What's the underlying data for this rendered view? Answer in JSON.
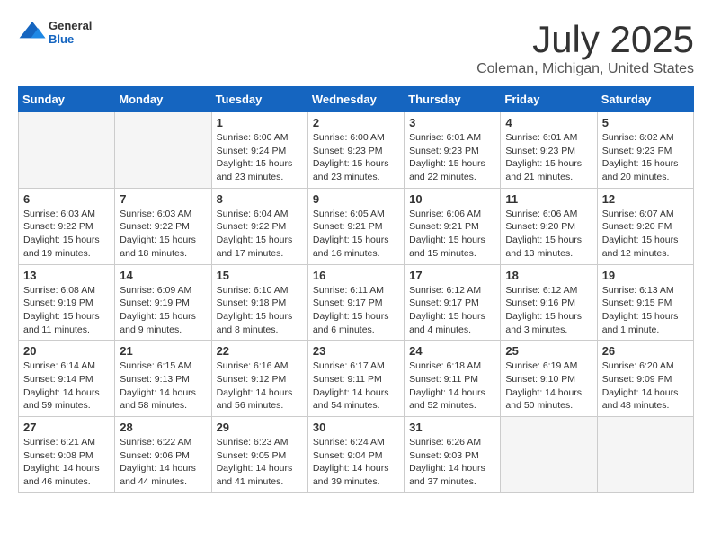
{
  "header": {
    "logo_general": "General",
    "logo_blue": "Blue",
    "month_title": "July 2025",
    "location": "Coleman, Michigan, United States"
  },
  "weekdays": [
    "Sunday",
    "Monday",
    "Tuesday",
    "Wednesday",
    "Thursday",
    "Friday",
    "Saturday"
  ],
  "weeks": [
    [
      {
        "day": "",
        "empty": true
      },
      {
        "day": "",
        "empty": true
      },
      {
        "day": "1",
        "sunrise": "6:00 AM",
        "sunset": "9:24 PM",
        "daylight": "15 hours and 23 minutes."
      },
      {
        "day": "2",
        "sunrise": "6:00 AM",
        "sunset": "9:23 PM",
        "daylight": "15 hours and 23 minutes."
      },
      {
        "day": "3",
        "sunrise": "6:01 AM",
        "sunset": "9:23 PM",
        "daylight": "15 hours and 22 minutes."
      },
      {
        "day": "4",
        "sunrise": "6:01 AM",
        "sunset": "9:23 PM",
        "daylight": "15 hours and 21 minutes."
      },
      {
        "day": "5",
        "sunrise": "6:02 AM",
        "sunset": "9:23 PM",
        "daylight": "15 hours and 20 minutes."
      }
    ],
    [
      {
        "day": "6",
        "sunrise": "6:03 AM",
        "sunset": "9:22 PM",
        "daylight": "15 hours and 19 minutes."
      },
      {
        "day": "7",
        "sunrise": "6:03 AM",
        "sunset": "9:22 PM",
        "daylight": "15 hours and 18 minutes."
      },
      {
        "day": "8",
        "sunrise": "6:04 AM",
        "sunset": "9:22 PM",
        "daylight": "15 hours and 17 minutes."
      },
      {
        "day": "9",
        "sunrise": "6:05 AM",
        "sunset": "9:21 PM",
        "daylight": "15 hours and 16 minutes."
      },
      {
        "day": "10",
        "sunrise": "6:06 AM",
        "sunset": "9:21 PM",
        "daylight": "15 hours and 15 minutes."
      },
      {
        "day": "11",
        "sunrise": "6:06 AM",
        "sunset": "9:20 PM",
        "daylight": "15 hours and 13 minutes."
      },
      {
        "day": "12",
        "sunrise": "6:07 AM",
        "sunset": "9:20 PM",
        "daylight": "15 hours and 12 minutes."
      }
    ],
    [
      {
        "day": "13",
        "sunrise": "6:08 AM",
        "sunset": "9:19 PM",
        "daylight": "15 hours and 11 minutes."
      },
      {
        "day": "14",
        "sunrise": "6:09 AM",
        "sunset": "9:19 PM",
        "daylight": "15 hours and 9 minutes."
      },
      {
        "day": "15",
        "sunrise": "6:10 AM",
        "sunset": "9:18 PM",
        "daylight": "15 hours and 8 minutes."
      },
      {
        "day": "16",
        "sunrise": "6:11 AM",
        "sunset": "9:17 PM",
        "daylight": "15 hours and 6 minutes."
      },
      {
        "day": "17",
        "sunrise": "6:12 AM",
        "sunset": "9:17 PM",
        "daylight": "15 hours and 4 minutes."
      },
      {
        "day": "18",
        "sunrise": "6:12 AM",
        "sunset": "9:16 PM",
        "daylight": "15 hours and 3 minutes."
      },
      {
        "day": "19",
        "sunrise": "6:13 AM",
        "sunset": "9:15 PM",
        "daylight": "15 hours and 1 minute."
      }
    ],
    [
      {
        "day": "20",
        "sunrise": "6:14 AM",
        "sunset": "9:14 PM",
        "daylight": "14 hours and 59 minutes."
      },
      {
        "day": "21",
        "sunrise": "6:15 AM",
        "sunset": "9:13 PM",
        "daylight": "14 hours and 58 minutes."
      },
      {
        "day": "22",
        "sunrise": "6:16 AM",
        "sunset": "9:12 PM",
        "daylight": "14 hours and 56 minutes."
      },
      {
        "day": "23",
        "sunrise": "6:17 AM",
        "sunset": "9:11 PM",
        "daylight": "14 hours and 54 minutes."
      },
      {
        "day": "24",
        "sunrise": "6:18 AM",
        "sunset": "9:11 PM",
        "daylight": "14 hours and 52 minutes."
      },
      {
        "day": "25",
        "sunrise": "6:19 AM",
        "sunset": "9:10 PM",
        "daylight": "14 hours and 50 minutes."
      },
      {
        "day": "26",
        "sunrise": "6:20 AM",
        "sunset": "9:09 PM",
        "daylight": "14 hours and 48 minutes."
      }
    ],
    [
      {
        "day": "27",
        "sunrise": "6:21 AM",
        "sunset": "9:08 PM",
        "daylight": "14 hours and 46 minutes."
      },
      {
        "day": "28",
        "sunrise": "6:22 AM",
        "sunset": "9:06 PM",
        "daylight": "14 hours and 44 minutes."
      },
      {
        "day": "29",
        "sunrise": "6:23 AM",
        "sunset": "9:05 PM",
        "daylight": "14 hours and 41 minutes."
      },
      {
        "day": "30",
        "sunrise": "6:24 AM",
        "sunset": "9:04 PM",
        "daylight": "14 hours and 39 minutes."
      },
      {
        "day": "31",
        "sunrise": "6:26 AM",
        "sunset": "9:03 PM",
        "daylight": "14 hours and 37 minutes."
      },
      {
        "day": "",
        "empty": true
      },
      {
        "day": "",
        "empty": true
      }
    ]
  ],
  "labels": {
    "sunrise": "Sunrise:",
    "sunset": "Sunset:",
    "daylight": "Daylight:"
  }
}
